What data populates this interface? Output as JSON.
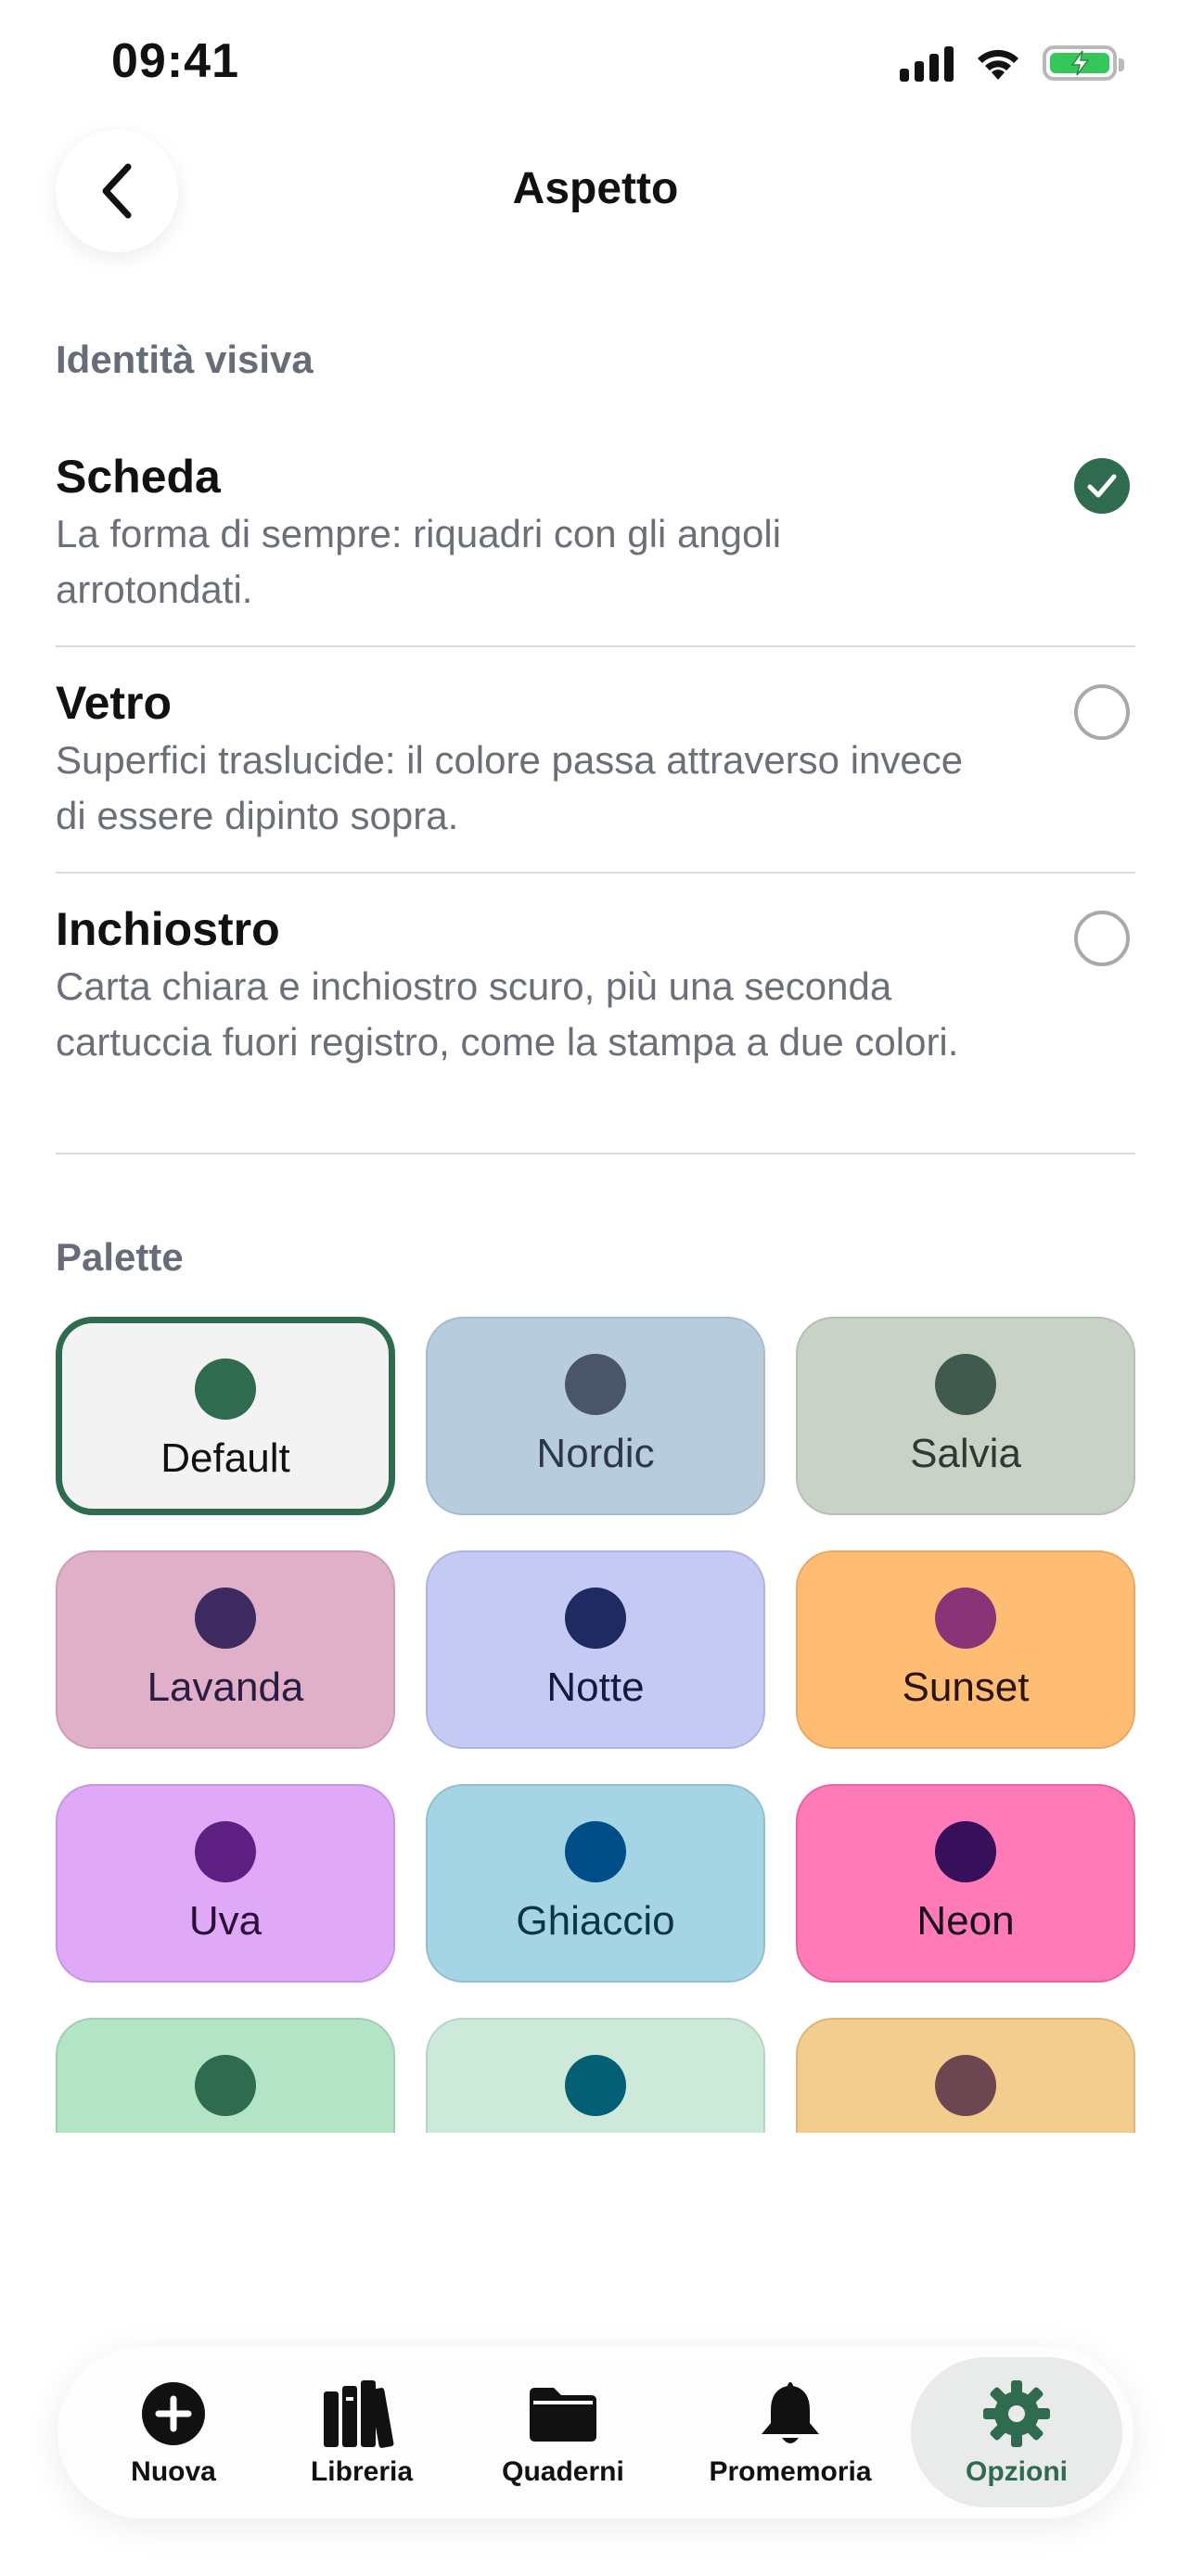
{
  "status_bar": {
    "time": "09:41",
    "icons": [
      "cellular-signal-icon",
      "wifi-icon",
      "battery-charging-icon"
    ]
  },
  "header": {
    "title": "Aspetto",
    "back_icon": "chevron-left-icon"
  },
  "identity": {
    "section_label": "Identità visiva",
    "options": [
      {
        "title": "Scheda",
        "description": "La forma di sempre: riquadri con gli angoli arrotondati.",
        "selected": true
      },
      {
        "title": "Vetro",
        "description": "Superfici traslucide: il colore passa attraverso invece di essere dipinto sopra.",
        "selected": false
      },
      {
        "title": "Inchiostro",
        "description": "Carta chiara e inchiostro scuro, più una seconda cartuccia fuori registro, come la stampa a due colori.",
        "selected": false
      }
    ]
  },
  "palette": {
    "section_label": "Palette",
    "items": [
      {
        "name": "Default",
        "bg": "#f3f3f3",
        "dot": "#2e6b4f",
        "border": "#2e6b4f",
        "text": "#111111",
        "selected": true
      },
      {
        "name": "Nordic",
        "bg": "#b7ccdd",
        "dot": "#4a5568",
        "border": "#a5bacb",
        "text": "#2d3748",
        "selected": false
      },
      {
        "name": "Salvia",
        "bg": "#c8d2c6",
        "dot": "#415a50",
        "border": "#b5bfb3",
        "text": "#2d3a34",
        "selected": false
      },
      {
        "name": "Lavanda",
        "bg": "#dfb0c8",
        "dot": "#3d2a60",
        "border": "#cc9db5",
        "text": "#2a1d44",
        "selected": false
      },
      {
        "name": "Notte",
        "bg": "#c4caf4",
        "dot": "#1f2a63",
        "border": "#aeb5e0",
        "text": "#141a3d",
        "selected": false
      },
      {
        "name": "Sunset",
        "bg": "#ffbd74",
        "dot": "#8a3477",
        "border": "#e9a862",
        "text": "#2a1410",
        "selected": false
      },
      {
        "name": "Uva",
        "bg": "#dfa9f7",
        "dot": "#5e2183",
        "border": "#c894e2",
        "text": "#2a1038",
        "selected": false
      },
      {
        "name": "Ghiaccio",
        "bg": "#a5d5e4",
        "dot": "#004e87",
        "border": "#90c0d0",
        "text": "#0c3348",
        "selected": false
      },
      {
        "name": "Neon",
        "bg": "#ff7bb8",
        "dot": "#380f5b",
        "border": "#e8629f",
        "text": "#1a0a1e",
        "selected": false
      },
      {
        "name": "",
        "bg": "#b4e4c6",
        "dot": "#2e6b4f",
        "border": "#9dd0b0",
        "text": "#111111",
        "selected": false
      },
      {
        "name": "",
        "bg": "#cce9da",
        "dot": "#035f73",
        "border": "#b6d6c5",
        "text": "#111111",
        "selected": false
      },
      {
        "name": "",
        "bg": "#f2cd8e",
        "dot": "#6c4752",
        "border": "#dcb678",
        "text": "#111111",
        "selected": false
      }
    ]
  },
  "tab_bar": {
    "tabs": [
      {
        "label": "Nuova",
        "icon": "plus-circle-icon",
        "active": false
      },
      {
        "label": "Libreria",
        "icon": "books-icon",
        "active": false
      },
      {
        "label": "Quaderni",
        "icon": "folder-icon",
        "active": false
      },
      {
        "label": "Promemoria",
        "icon": "bell-icon",
        "active": false
      },
      {
        "label": "Opzioni",
        "icon": "gear-icon",
        "active": true
      }
    ]
  },
  "colors": {
    "accent": "#2e6b4f",
    "secondary_text": "#6b7078",
    "section_label": "#666d78"
  }
}
